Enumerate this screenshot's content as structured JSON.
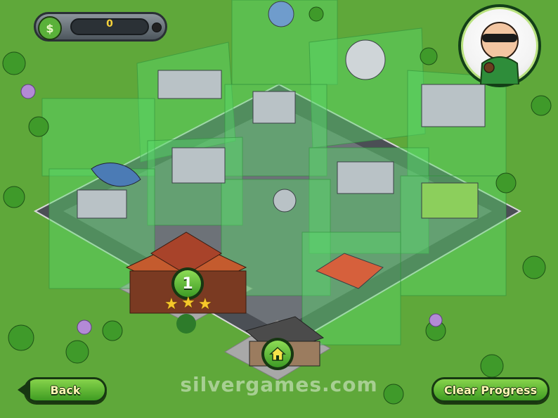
{
  "hud": {
    "money_icon": "cash-icon",
    "money_value": "0"
  },
  "character": {
    "name_icon": "robber-portrait"
  },
  "levels": [
    {
      "number": "1",
      "stars": 3,
      "unlocked": true
    }
  ],
  "buttons": {
    "back_label": "Back",
    "clear_label": "Clear Progress"
  },
  "watermark": "silvergames.com",
  "colors": {
    "grass": "#5fa83a",
    "road": "#4b4f55",
    "locked_glass": "#59d96a",
    "button_green": "#5bb52f",
    "button_text": "#fff6b3"
  }
}
